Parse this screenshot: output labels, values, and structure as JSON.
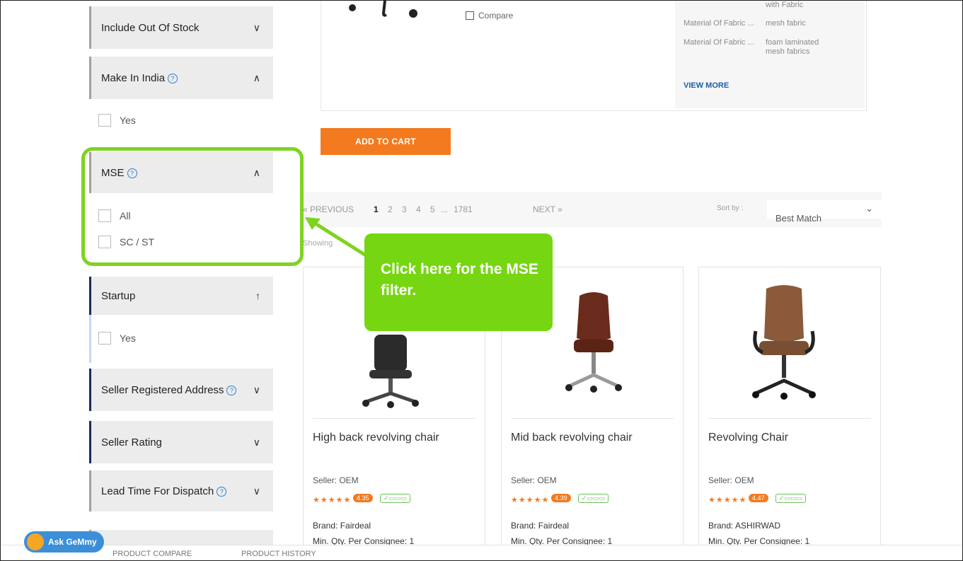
{
  "filters": [
    {
      "label": "Include Out Of Stock",
      "chev": "∨",
      "help": false
    },
    {
      "label": "Make In India",
      "chev": "∧",
      "help": true
    },
    {
      "label": "MSE",
      "chev": "∧",
      "help": true
    },
    {
      "label": "Startup",
      "chev": "↑",
      "help": false
    },
    {
      "label": "Seller Registered Address",
      "chev": "∨",
      "help": true
    },
    {
      "label": "Seller Rating",
      "chev": "∨",
      "help": false
    },
    {
      "label": "Lead Time For Dispatch",
      "chev": "∨",
      "help": true
    }
  ],
  "make_in_india_options": [
    "Yes"
  ],
  "mse_options": [
    "All",
    "SC / ST"
  ],
  "startup_options": [
    "Yes"
  ],
  "top_card": {
    "compare": "Compare",
    "specs": [
      {
        "key": "",
        "value": "with Fabric"
      },
      {
        "key": "Material Of Fabric ...",
        "value": "mesh fabric"
      },
      {
        "key": "Material Of Fabric ...",
        "value": "foam laminated mesh fabrics"
      }
    ],
    "view_more": "VIEW MORE",
    "add_to_cart": "ADD TO CART"
  },
  "pager": {
    "previous": "« PREVIOUS",
    "pages": [
      "1",
      "2",
      "3",
      "4",
      "5",
      "...",
      "1781"
    ],
    "next": "NEXT »",
    "sort_label": "Sort by :",
    "sort_value": "Best Match",
    "showing": "Showing"
  },
  "callout": {
    "text": "Click here for the MSE filter."
  },
  "products": [
    {
      "name": "High back revolving chair",
      "seller": "Seller: OEM",
      "rating": "4.35",
      "brand": "Brand: Fairdeal",
      "min_qty": "Min. Qty. Per Consignee: 1"
    },
    {
      "name": "Mid back revolving chair",
      "seller": "Seller: OEM",
      "rating": "4.39",
      "brand": "Brand: Fairdeal",
      "min_qty": "Min. Qty. Per Consignee: 1"
    },
    {
      "name": "Revolving Chair",
      "seller": "Seller: OEM",
      "rating": "4.47",
      "brand": "Brand: ASHIRWAD",
      "min_qty": "Min. Qty. Per Consignee: 1"
    }
  ],
  "assistant": {
    "label": "Ask GeMmy"
  },
  "bottom_bar": {
    "compare": "PRODUCT COMPARE",
    "history": "PRODUCT HISTORY"
  }
}
